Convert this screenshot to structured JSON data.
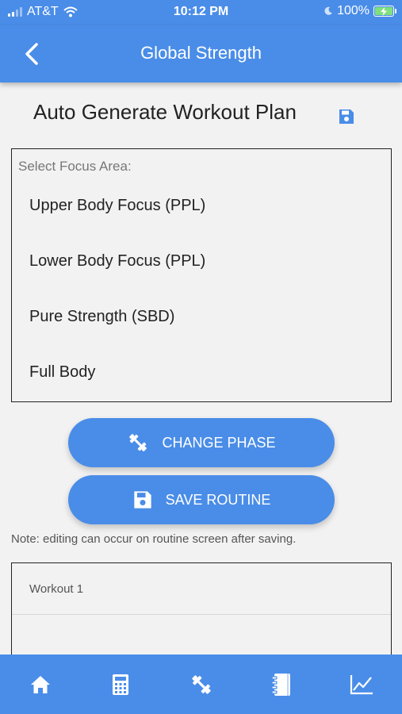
{
  "status_bar": {
    "carrier": "AT&T",
    "time": "10:12 PM",
    "battery": "100%"
  },
  "nav": {
    "title": "Global Strength"
  },
  "page": {
    "title": "Auto Generate Workout Plan"
  },
  "focus": {
    "label": "Select Focus Area:",
    "options": [
      "Upper Body Focus (PPL)",
      "Lower Body Focus (PPL)",
      "Pure Strength (SBD)",
      "Full Body"
    ]
  },
  "actions": {
    "change_phase": "CHANGE PHASE",
    "save_routine": "SAVE ROUTINE"
  },
  "note": "Note: editing can occur on routine screen after saving.",
  "workouts": [
    {
      "label": "Workout 1"
    }
  ],
  "tabs": [
    {
      "icon": "home-icon"
    },
    {
      "icon": "calculator-icon"
    },
    {
      "icon": "dumbbell-icon"
    },
    {
      "icon": "notebook-icon"
    },
    {
      "icon": "chart-icon"
    }
  ],
  "colors": {
    "accent": "#4a8de8",
    "background": "#f2f2f2"
  }
}
